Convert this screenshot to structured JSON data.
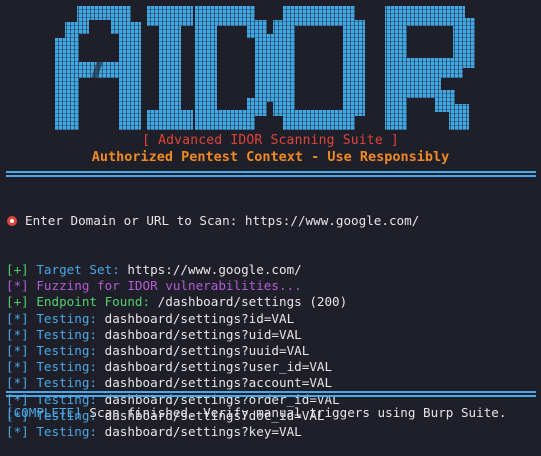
{
  "banner": {
    "logo_text": "IDOR",
    "subtitle": "[ Advanced IDOR Scanning Suite ]",
    "context": "Authorized Pentest Context - Use Responsibly"
  },
  "colors": {
    "background": "#1e1f29",
    "logo_fill": "#41a9e6",
    "subtitle_red": "#e0443a",
    "context_orange": "#f08a24",
    "rule_blue": "#4aa8e8",
    "green": "#4fd16c",
    "blue": "#4aa8e8",
    "magenta": "#b35bd6"
  },
  "prompt": {
    "icon": "target-icon",
    "text": "Enter Domain or URL to Scan: https://www.google.com/"
  },
  "log": [
    {
      "tag": "[+]",
      "tag_color": "green",
      "label": "Target Set:",
      "label_color": "blue",
      "value": "https://www.google.com/"
    },
    {
      "tag": "[*]",
      "tag_color": "magenta",
      "label": "Fuzzing for IDOR vulnerabilities...",
      "label_color": "magenta",
      "value": ""
    },
    {
      "tag": "[+]",
      "tag_color": "green",
      "label": "Endpoint Found:",
      "label_color": "green",
      "value": "/dashboard/settings (200)"
    },
    {
      "tag": "[*]",
      "tag_color": "blue",
      "label": "Testing:",
      "label_color": "blue",
      "value": "dashboard/settings?id=VAL"
    },
    {
      "tag": "[*]",
      "tag_color": "blue",
      "label": "Testing:",
      "label_color": "blue",
      "value": "dashboard/settings?uid=VAL"
    },
    {
      "tag": "[*]",
      "tag_color": "blue",
      "label": "Testing:",
      "label_color": "blue",
      "value": "dashboard/settings?uuid=VAL"
    },
    {
      "tag": "[*]",
      "tag_color": "blue",
      "label": "Testing:",
      "label_color": "blue",
      "value": "dashboard/settings?user_id=VAL"
    },
    {
      "tag": "[*]",
      "tag_color": "blue",
      "label": "Testing:",
      "label_color": "blue",
      "value": "dashboard/settings?account=VAL"
    },
    {
      "tag": "[*]",
      "tag_color": "blue",
      "label": "Testing:",
      "label_color": "blue",
      "value": "dashboard/settings?order_id=VAL"
    },
    {
      "tag": "[*]",
      "tag_color": "blue",
      "label": "Testing:",
      "label_color": "blue",
      "value": "dashboard/settings?doc_id=VAL"
    },
    {
      "tag": "[*]",
      "tag_color": "blue",
      "label": "Testing:",
      "label_color": "blue",
      "value": "dashboard/settings?key=VAL"
    }
  ],
  "footer": {
    "tag": "[COMPLETE]",
    "text": "Scan finished. Verify manual triggers using Burp Suite."
  }
}
